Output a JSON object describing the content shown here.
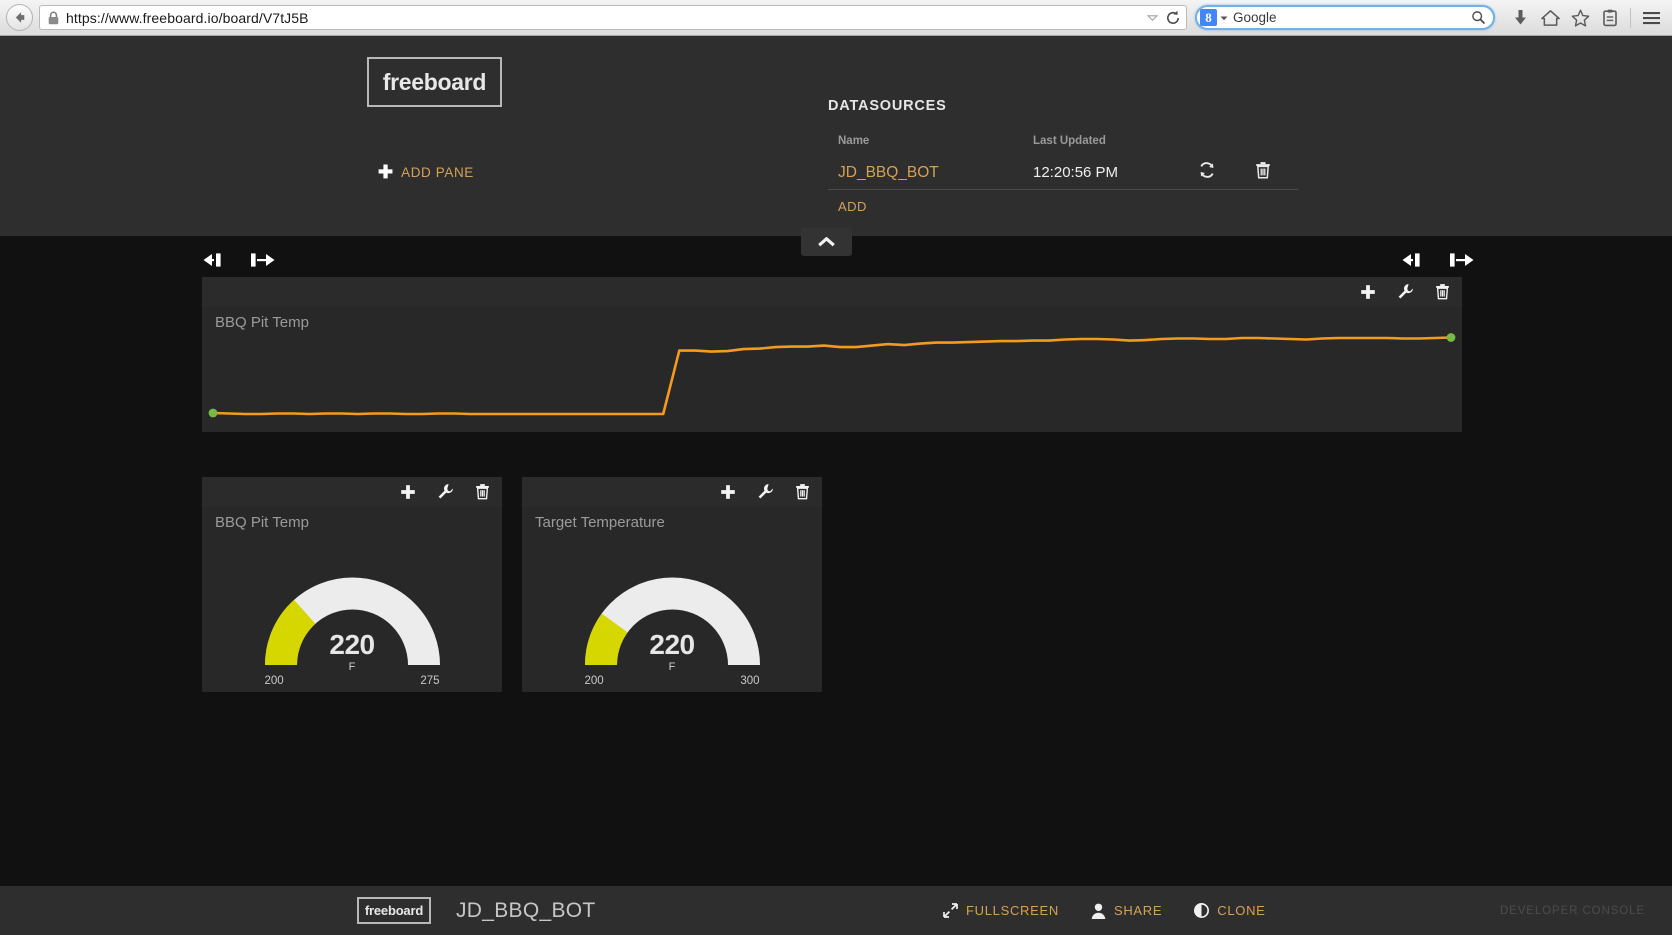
{
  "browser": {
    "url_scheme": "https://",
    "url_host": "www.freeboard.io",
    "url_path": "/board/V7tJ5B",
    "url_full": "https://www.freeboard.io/board/V7tJ5B",
    "search_engine_label": "Google",
    "search_placeholder": "Google",
    "icons": {
      "back": "back-arrow-icon",
      "lock": "lock-icon",
      "dropdown": "chevron-down-icon",
      "reload": "reload-icon",
      "search": "search-icon",
      "downloads": "download-arrow-icon",
      "home": "home-icon",
      "bookmark": "star-icon",
      "library": "library-icon",
      "menu": "hamburger-menu-icon"
    }
  },
  "header": {
    "logo_text": "freeboard",
    "add_pane_label": "ADD PANE",
    "datasources": {
      "title": "DATASOURCES",
      "columns": [
        "Name",
        "Last Updated"
      ],
      "rows": [
        {
          "name": "JD_BBQ_BOT",
          "last_updated": "12:20:56 PM"
        }
      ],
      "add_label": "ADD"
    }
  },
  "board": {
    "collapse_label": "chevron-up-icon",
    "panes": [
      {
        "id": "pane-bbq-pit-temp-chart",
        "title": "BBQ Pit Temp",
        "widget": "sparkline",
        "tools": [
          "plus-icon",
          "wrench-icon",
          "trash-icon"
        ]
      },
      {
        "id": "pane-bbq-pit-temp-gauge",
        "title": "BBQ Pit Temp",
        "widget": "gauge",
        "tools": [
          "plus-icon",
          "wrench-icon",
          "trash-icon"
        ],
        "gauge": {
          "value": "220",
          "unit": "F",
          "min": "200",
          "max": "275"
        }
      },
      {
        "id": "pane-target-temperature-gauge",
        "title": "Target Temperature",
        "widget": "gauge",
        "tools": [
          "plus-icon",
          "wrench-icon",
          "trash-icon"
        ],
        "gauge": {
          "value": "220",
          "unit": "F",
          "min": "200",
          "max": "300"
        }
      }
    ]
  },
  "footer": {
    "logo_text": "freeboard",
    "board_name": "JD_BBQ_BOT",
    "actions": [
      {
        "label": "FULLSCREEN",
        "icon": "fullscreen-icon"
      },
      {
        "label": "SHARE",
        "icon": "person-icon"
      },
      {
        "label": "CLONE",
        "icon": "half-circle-icon"
      }
    ],
    "developer_console_label": "DEVELOPER CONSOLE"
  },
  "colors": {
    "accent": "#d4a256",
    "line": "#f59b1b",
    "marker": "#76bb3f",
    "gauge_fill": "#d6d600",
    "gauge_track": "#ececec",
    "header_bg": "#2e2e2e",
    "body_bg": "#111111",
    "pane_bg": "#282828"
  },
  "chart_data": {
    "type": "line",
    "title": "BBQ Pit Temp",
    "xlabel": "",
    "ylabel": "",
    "grid": false,
    "legend": null,
    "series": [
      {
        "name": "BBQ Pit Temp",
        "color": "#f59b1b",
        "start_marker": true,
        "end_marker": true,
        "y": [
          72,
          71,
          70,
          70,
          71,
          71,
          70,
          71,
          71,
          70,
          71,
          71,
          70,
          70,
          71,
          71,
          70,
          70,
          70,
          70,
          70,
          70,
          70,
          70,
          70,
          70,
          70,
          70,
          70,
          196,
          196,
          194,
          195,
          199,
          200,
          203,
          204,
          204,
          206,
          203,
          203,
          206,
          209,
          207,
          210,
          212,
          212,
          213,
          214,
          215,
          215,
          216,
          216,
          218,
          219,
          219,
          218,
          216,
          217,
          219,
          220,
          220,
          219,
          219,
          221,
          221,
          220,
          219,
          218,
          220,
          221,
          221,
          221,
          221,
          220,
          220,
          221,
          222
        ]
      }
    ],
    "ylim": [
      60,
      235
    ],
    "note": "Temperature rises sharply around sample 29 then plateaus near 220 F"
  },
  "gauges": [
    {
      "name": "BBQ Pit Temp",
      "value": 220,
      "min": 200,
      "max": 275,
      "unit": "F",
      "fraction": 0.267
    },
    {
      "name": "Target Temperature",
      "value": 220,
      "min": 200,
      "max": 300,
      "unit": "F",
      "fraction": 0.2
    }
  ]
}
